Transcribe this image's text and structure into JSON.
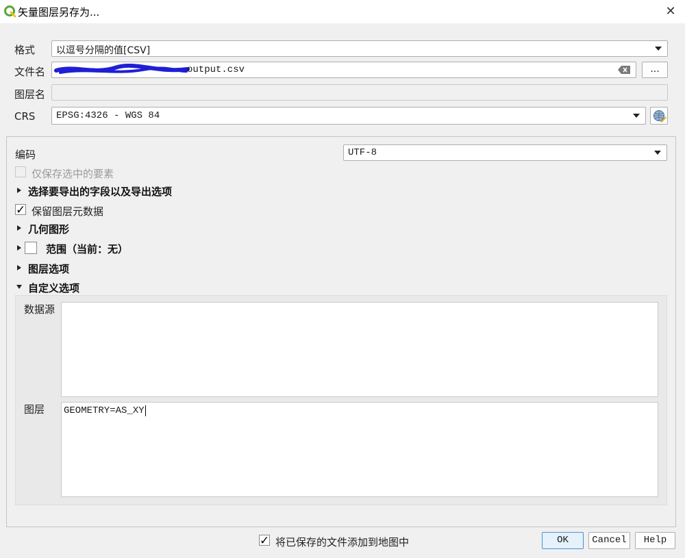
{
  "window": {
    "title": "矢量图层另存为...",
    "close_glyph": "✕"
  },
  "format": {
    "label": "格式",
    "value": "以逗号分隔的值[CSV]"
  },
  "filename": {
    "label": "文件名",
    "value": "output.csv",
    "browse_label": "..."
  },
  "layer_name": {
    "label": "图层名",
    "value": ""
  },
  "crs": {
    "label": "CRS",
    "value": "EPSG:4326 - WGS 84"
  },
  "encoding": {
    "label": "编码",
    "value": "UTF-8"
  },
  "save_selected": {
    "label": "仅保存选中的要素",
    "checked": false,
    "enabled": false
  },
  "sections": {
    "fields": "选择要导出的字段以及导出选项",
    "geometry": "几何图形",
    "extent": "范围（当前：无）",
    "layer_options": "图层选项",
    "custom_options": "自定义选项"
  },
  "persist_metadata": {
    "label": "保留图层元数据",
    "checked": true
  },
  "custom": {
    "datasource_label": "数据源",
    "datasource_value": "",
    "layer_label": "图层",
    "layer_value": "GEOMETRY=AS_XY"
  },
  "footer": {
    "add_to_map_label": "将已保存的文件添加到地图中",
    "add_to_map_checked": true,
    "ok": "OK",
    "cancel": "Cancel",
    "help": "Help"
  },
  "colors": {
    "accent": "#4a90d9",
    "qgis_green": "#59a536",
    "redaction": "#1f1fd6"
  },
  "icons": [
    "qgis-logo-icon",
    "close-icon",
    "clear-text-icon",
    "crs-selector-icon",
    "dropdown-arrow-icon",
    "expand-arrow-icon",
    "collapse-arrow-icon",
    "checkmark-icon"
  ]
}
